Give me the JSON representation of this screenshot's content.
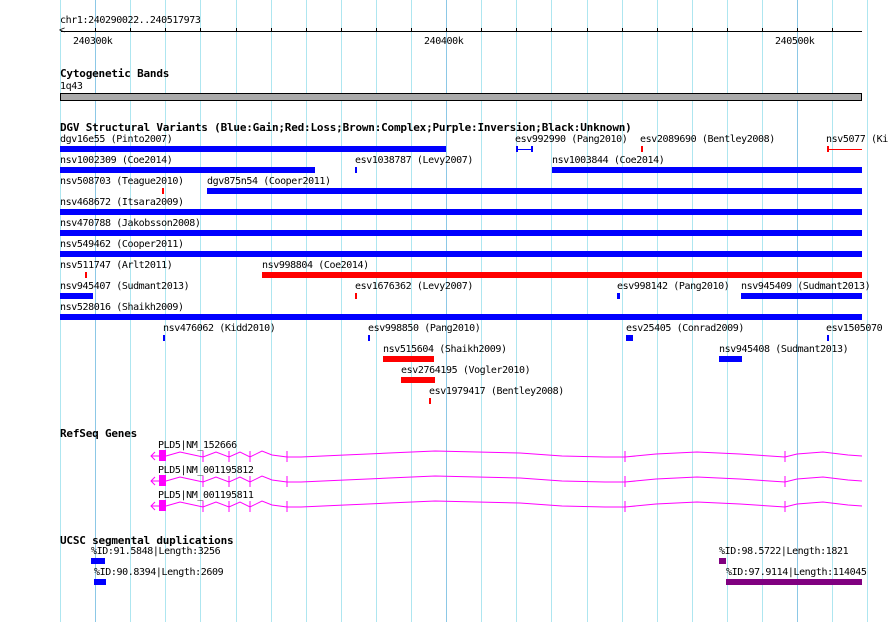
{
  "ruler": {
    "region": "chr1:240290022..240517973",
    "ticks": [
      "240300k",
      "240400k",
      "240500k"
    ]
  },
  "tracks": {
    "cytoband": {
      "title": "Cytogenetic Bands",
      "band": "1q43",
      "color": "#aaaaaa"
    },
    "dgv": {
      "title": "DGV Structural Variants (Blue:Gain;Red:Loss;Brown:Complex;Purple:Inversion;Black:Unknown)",
      "colors": {
        "gain": "#0000ff",
        "loss": "#ff0000"
      },
      "features": [
        {
          "label": "dgv16e55 (Pinto2007)",
          "type": "gain"
        },
        {
          "label": "esv992990 (Pang2010)",
          "type": "gain"
        },
        {
          "label": "esv2089690 (Bentley2008)",
          "type": "loss"
        },
        {
          "label": "nsv5077 (Ki",
          "type": "loss"
        },
        {
          "label": "nsv1002309 (Coe2014)",
          "type": "gain"
        },
        {
          "label": "esv1038787 (Levy2007)",
          "type": "gain"
        },
        {
          "label": "nsv1003844 (Coe2014)",
          "type": "gain"
        },
        {
          "label": "nsv508703 (Teague2010)",
          "type": "loss"
        },
        {
          "label": "dgv875n54 (Cooper2011)",
          "type": "gain"
        },
        {
          "label": "nsv468672 (Itsara2009)",
          "type": "gain"
        },
        {
          "label": "nsv470788 (Jakobsson2008)",
          "type": "gain"
        },
        {
          "label": "nsv549462 (Cooper2011)",
          "type": "gain"
        },
        {
          "label": "nsv511747 (Arlt2011)",
          "type": "loss"
        },
        {
          "label": "nsv998804 (Coe2014)",
          "type": "loss"
        },
        {
          "label": "nsv945407 (Sudmant2013)",
          "type": "gain"
        },
        {
          "label": "esv1676362 (Levy2007)",
          "type": "loss"
        },
        {
          "label": "esv998142 (Pang2010)",
          "type": "gain"
        },
        {
          "label": "nsv945409 (Sudmant2013)",
          "type": "gain"
        },
        {
          "label": "nsv528016 (Shaikh2009)",
          "type": "gain"
        },
        {
          "label": "nsv476062 (Kidd2010)",
          "type": "gain"
        },
        {
          "label": "esv998850 (Pang2010)",
          "type": "gain"
        },
        {
          "label": "esv25405 (Conrad2009)",
          "type": "gain"
        },
        {
          "label": "esv1505070",
          "type": "gain"
        },
        {
          "label": "nsv515604 (Shaikh2009)",
          "type": "loss"
        },
        {
          "label": "nsv945408 (Sudmant2013)",
          "type": "gain"
        },
        {
          "label": "esv2764195 (Vogler2010)",
          "type": "loss"
        },
        {
          "label": "esv1979417 (Bentley2008)",
          "type": "loss"
        }
      ]
    },
    "refseq": {
      "title": "RefSeq Genes",
      "color": "#ff00ff",
      "genes": [
        {
          "label": "PLD5|NM_152666"
        },
        {
          "label": "PLD5|NM_001195812"
        },
        {
          "label": "PLD5|NM_001195811"
        }
      ]
    },
    "segdup": {
      "title": "UCSC segmental duplications",
      "features": [
        {
          "label": "%ID:91.5848|Length:3256",
          "color": "#0000ff"
        },
        {
          "label": "%ID:90.8394|Length:2609",
          "color": "#0000ff"
        },
        {
          "label": "%ID:98.5722|Length:1821",
          "color": "#800080"
        },
        {
          "label": "%ID:97.9114|Length:114045",
          "color": "#800080"
        }
      ]
    }
  }
}
